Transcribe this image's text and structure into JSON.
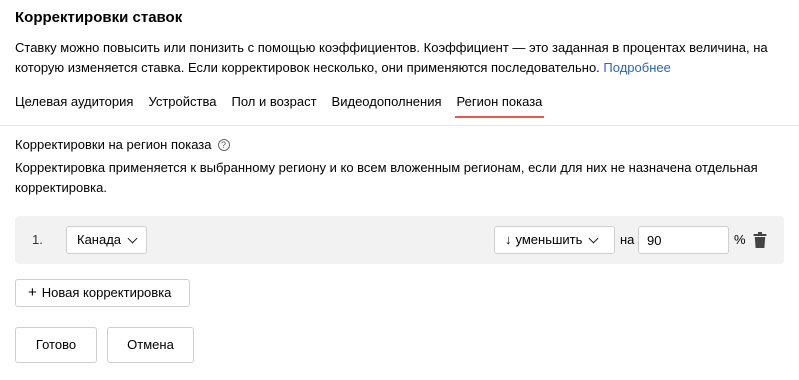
{
  "header": {
    "title": "Корректировки ставок",
    "description": "Ставку можно повысить или понизить с помощью коэффициентов. Коэффициент — это заданная в процентах величина, на которую изменяется ставка. Если корректировок несколько, они применяются последовательно.",
    "more_link": "Подробнее"
  },
  "tabs": [
    {
      "label": "Целевая аудитория",
      "active": false
    },
    {
      "label": "Устройства",
      "active": false
    },
    {
      "label": "Пол и возраст",
      "active": false
    },
    {
      "label": "Видеодополнения",
      "active": false
    },
    {
      "label": "Регион показа",
      "active": true
    }
  ],
  "section": {
    "title": "Корректировки на регион показа",
    "help_icon": "question-circle-icon",
    "description": "Корректировка применяется к выбранному региону и ко всем вложенным регионам, если для них не назначена отдельная корректировка."
  },
  "adjustments": [
    {
      "number": "1.",
      "region": "Канада",
      "action_arrow": "↓",
      "action": "уменьшить",
      "preposition": "на",
      "value": "90",
      "unit": "%",
      "delete_icon": "trash-icon"
    }
  ],
  "buttons": {
    "new_adjustment_icon": "+",
    "new_adjustment": "Новая корректировка",
    "done": "Готово",
    "cancel": "Отмена"
  },
  "colors": {
    "accent": "#f0524f",
    "link": "#2a64c2",
    "row_bg": "#f2f2f2"
  }
}
